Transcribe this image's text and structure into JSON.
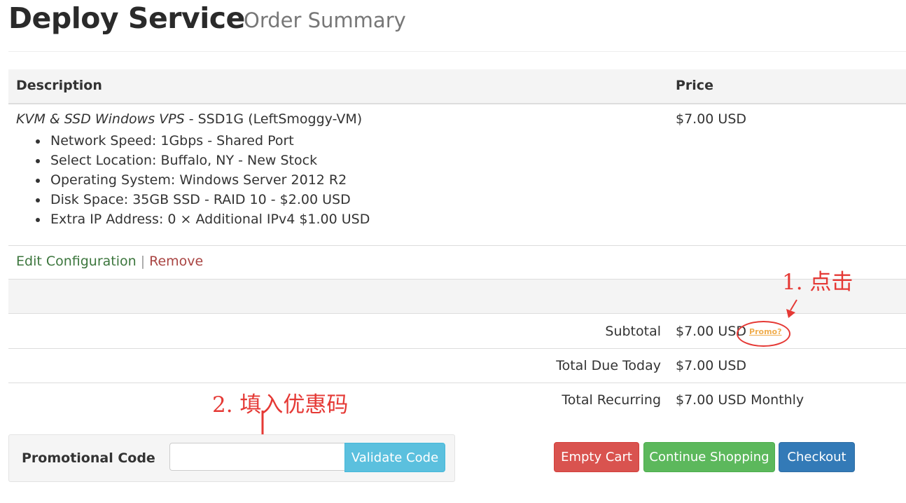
{
  "header": {
    "title": "Deploy Service",
    "subtitle": "Order Summary"
  },
  "table": {
    "columns": [
      "Description",
      "Price"
    ],
    "product": {
      "group": "KVM & SSD Windows VPS",
      "name": " - SSD1G (LeftSmoggy-VM)",
      "price": "$7.00 USD",
      "options": [
        "Network Speed: 1Gbps - Shared Port",
        "Select Location: Buffalo, NY - New Stock",
        "Operating System: Windows Server 2012 R2",
        "Disk Space: 35GB SSD - RAID 10 - $2.00 USD",
        "Extra IP Address: 0 × Additional IPv4 $1.00 USD"
      ]
    },
    "actions": {
      "edit": "Edit Configuration",
      "separator": "|",
      "remove": "Remove"
    }
  },
  "totals": {
    "subtotal": {
      "label": "Subtotal",
      "value": "$7.00 USD",
      "promo_link": "Promo?"
    },
    "due_today": {
      "label": "Total Due Today",
      "value": "$7.00 USD"
    },
    "recurring": {
      "label": "Total Recurring",
      "value": "$7.00 USD Monthly"
    }
  },
  "annotations": {
    "step1": "1. 点击",
    "step2": "2. 填入优惠码",
    "color": "#e53935"
  },
  "promo": {
    "label": "Promotional Code",
    "input_value": "",
    "button": "Validate Code"
  },
  "buttons": {
    "empty_cart": "Empty Cart",
    "continue_shopping": "Continue Shopping",
    "checkout": "Checkout"
  },
  "colors": {
    "danger": "#d9534f",
    "success": "#5cb85c",
    "primary": "#337ab7",
    "info": "#5bc0de",
    "promo_link": "#f0ad4e",
    "edit_link": "#3c763d",
    "remove_link": "#a94442"
  }
}
